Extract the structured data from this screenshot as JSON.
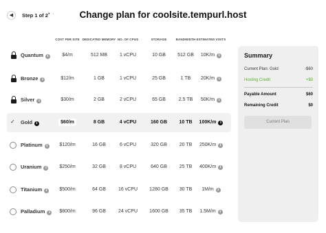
{
  "header": {
    "step_label": "Step 1 of 2",
    "step_dots": "• ·",
    "title": "Change plan for coolsite.tempurl.host"
  },
  "columns": [
    "COST PER SITE",
    "DEDICATED MEMORY",
    "NO. OF CPUS",
    "STORAGE",
    "BANDWIDTH",
    "ESTIMATED VISITS"
  ],
  "plans": [
    {
      "name": "Quantum",
      "state": "locked",
      "cost": "$4/m",
      "memory": "512 MB",
      "cpus": "1 vCPU",
      "storage": "10 GB",
      "bandwidth": "512 GB",
      "visits": "10K/m"
    },
    {
      "name": "Bronze",
      "state": "locked",
      "cost": "$12/m",
      "memory": "1 GB",
      "cpus": "1 vCPU",
      "storage": "25 GB",
      "bandwidth": "1 TB",
      "visits": "20K/m"
    },
    {
      "name": "Silver",
      "state": "locked",
      "cost": "$30/m",
      "memory": "2 GB",
      "cpus": "2 vCPU",
      "storage": "65 GB",
      "bandwidth": "2.5 TB",
      "visits": "50K/m"
    },
    {
      "name": "Gold",
      "state": "selected",
      "cost": "$60/m",
      "memory": "8 GB",
      "cpus": "4 vCPU",
      "storage": "160 GB",
      "bandwidth": "10 TB",
      "visits": "100K/m"
    },
    {
      "name": "Platinum",
      "state": "option",
      "cost": "$120/m",
      "memory": "16 GB",
      "cpus": "6 vCPU",
      "storage": "320 GB",
      "bandwidth": "20 TB",
      "visits": "250K/m"
    },
    {
      "name": "Uranium",
      "state": "option",
      "cost": "$250/m",
      "memory": "32 GB",
      "cpus": "8 vCPU",
      "storage": "640 GB",
      "bandwidth": "25 TB",
      "visits": "400K/m"
    },
    {
      "name": "Titanium",
      "state": "option",
      "cost": "$500/m",
      "memory": "64 GB",
      "cpus": "16 vCPU",
      "storage": "1280 GB",
      "bandwidth": "30 TB",
      "visits": "1M/m"
    },
    {
      "name": "Palladium",
      "state": "option",
      "cost": "$800/m",
      "memory": "96 GB",
      "cpus": "24 vCPU",
      "storage": "1600 GB",
      "bandwidth": "35 TB",
      "visits": "1.5M/m"
    }
  ],
  "summary": {
    "title": "Summary",
    "current_plan_label": "Current Plan: Gold",
    "current_plan_value": "-$60",
    "hosting_credit_label": "Hosting Credit",
    "hosting_credit_value": "+$0",
    "payable_label": "Payable Amount",
    "payable_value": "$60",
    "remaining_label": "Remaining Credit",
    "remaining_value": "$0",
    "button_label": "Current Plan"
  },
  "colors": {
    "credit": "#5caa3a",
    "summary_bg": "#efefef",
    "selected_row_bg": "#f1f1f1"
  }
}
